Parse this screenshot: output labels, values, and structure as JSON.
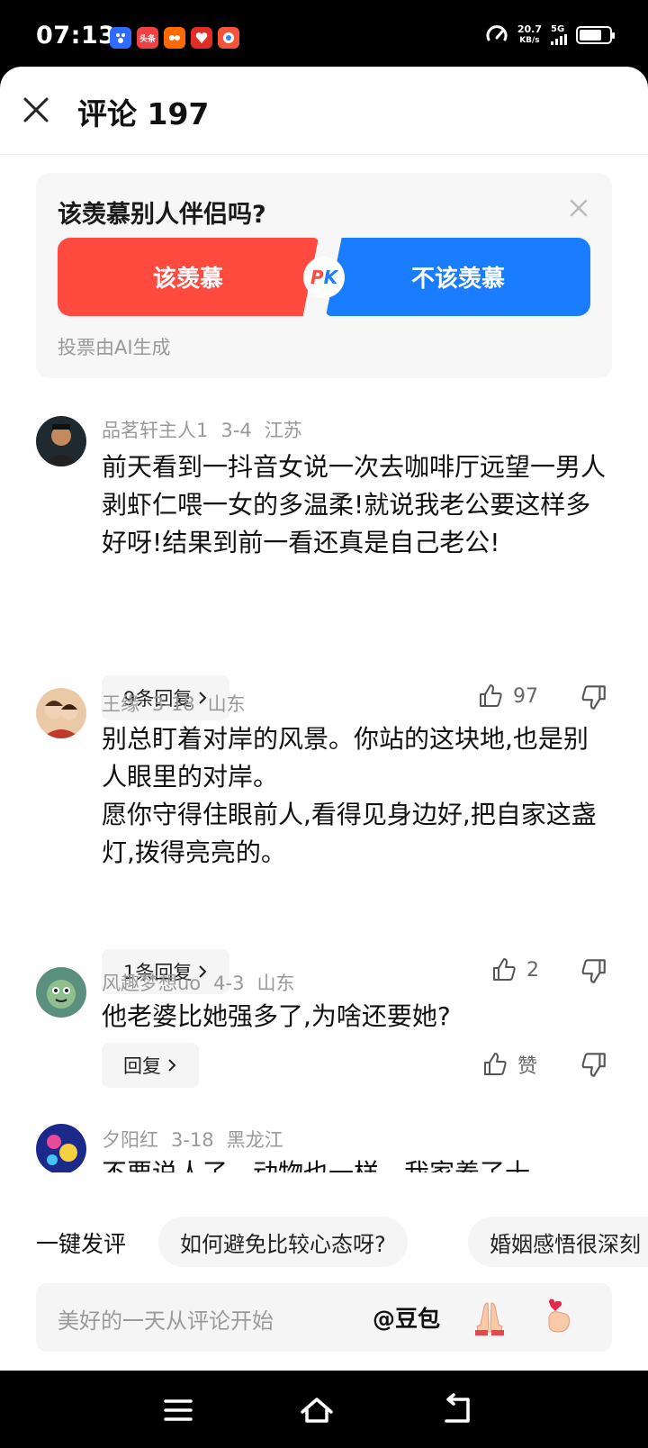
{
  "status_bar": {
    "time": "07:13",
    "apps": [
      {
        "name": "baidu-app-icon",
        "label": "",
        "color": "#2f6bff"
      },
      {
        "name": "toutiao-app-icon",
        "label": "头条",
        "color": "#f04142"
      },
      {
        "name": "taobao-app-icon",
        "label": "",
        "color": "#ff6a00"
      },
      {
        "name": "pinduoduo-app-icon",
        "label": "",
        "color": "#e02e24"
      },
      {
        "name": "game-app-icon",
        "label": "",
        "color": "#f2553c"
      }
    ],
    "speed_value": "20.7",
    "speed_unit": "KB/s",
    "network": "5G",
    "battery_level": 0.75
  },
  "header": {
    "title": "评论 197"
  },
  "vote": {
    "question": "该羡慕别人伴侣吗?",
    "option_yes": "该羡慕",
    "option_no": "不该羡慕",
    "pk_p": "P",
    "pk_k": "K",
    "footnote": "投票由AI生成",
    "colors": {
      "yes": "#ff4a40",
      "no": "#1a7cff"
    }
  },
  "comments": [
    {
      "user": "品茗轩主人1",
      "date": "3-4",
      "location": "江苏",
      "text": "前天看到一抖音女说一次去咖啡厅远望一男人剥虾仁喂一女的多温柔!就说我老公要这样多好呀!结果到前一看还真是自己老公!",
      "reply_label": "9条回复",
      "likes": "97"
    },
    {
      "user": "王缘",
      "date": "3-18",
      "location": "山东",
      "text": "别总盯着对岸的风景。你站的这块地,也是别人眼里的对岸。\n愿你守得住眼前人,看得见身边好,把自家这盏灯,拨得亮亮的。",
      "reply_label": "1条回复",
      "likes": "2"
    },
    {
      "user": "风趣梦想uo",
      "date": "4-3",
      "location": "山东",
      "text": "他老婆比她强多了,为啥还要她?",
      "reply_label": "回复",
      "likes": "赞"
    },
    {
      "user": "夕阳红",
      "date": "3-18",
      "location": "黑龙江",
      "text": "不要说人了，动物也一样，我家养了十"
    }
  ],
  "quick_comment": {
    "label": "一键发评",
    "chips": [
      "如何避免比较心态呀?",
      "婚姻感悟很深刻"
    ]
  },
  "input": {
    "placeholder": "美好的一天从评论开始",
    "mention": "@豆包"
  }
}
